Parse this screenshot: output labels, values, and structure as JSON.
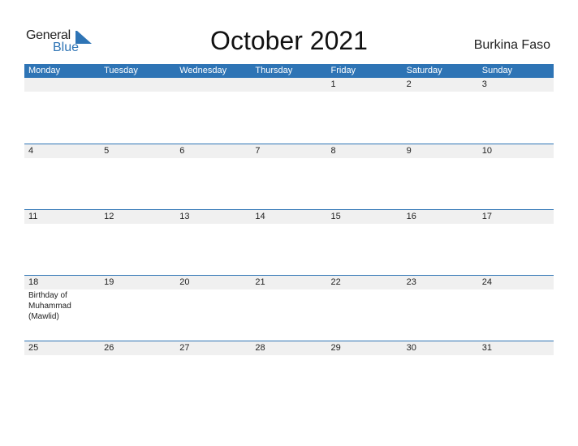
{
  "logo": {
    "general": "General",
    "blue": "Blue",
    "accent": "#2e74b5"
  },
  "title": "October 2021",
  "country": "Burkina Faso",
  "weekdays": [
    "Monday",
    "Tuesday",
    "Wednesday",
    "Thursday",
    "Friday",
    "Saturday",
    "Sunday"
  ],
  "weeks": [
    {
      "days": [
        "",
        "",
        "",
        "",
        "1",
        "2",
        "3"
      ],
      "events": [
        "",
        "",
        "",
        "",
        "",
        "",
        ""
      ]
    },
    {
      "days": [
        "4",
        "5",
        "6",
        "7",
        "8",
        "9",
        "10"
      ],
      "events": [
        "",
        "",
        "",
        "",
        "",
        "",
        ""
      ]
    },
    {
      "days": [
        "11",
        "12",
        "13",
        "14",
        "15",
        "16",
        "17"
      ],
      "events": [
        "",
        "",
        "",
        "",
        "",
        "",
        ""
      ]
    },
    {
      "days": [
        "18",
        "19",
        "20",
        "21",
        "22",
        "23",
        "24"
      ],
      "events": [
        "Birthday of Muhammad (Mawlid)",
        "",
        "",
        "",
        "",
        "",
        ""
      ]
    },
    {
      "days": [
        "25",
        "26",
        "27",
        "28",
        "29",
        "30",
        "31"
      ],
      "events": [
        "",
        "",
        "",
        "",
        "",
        "",
        ""
      ]
    }
  ]
}
